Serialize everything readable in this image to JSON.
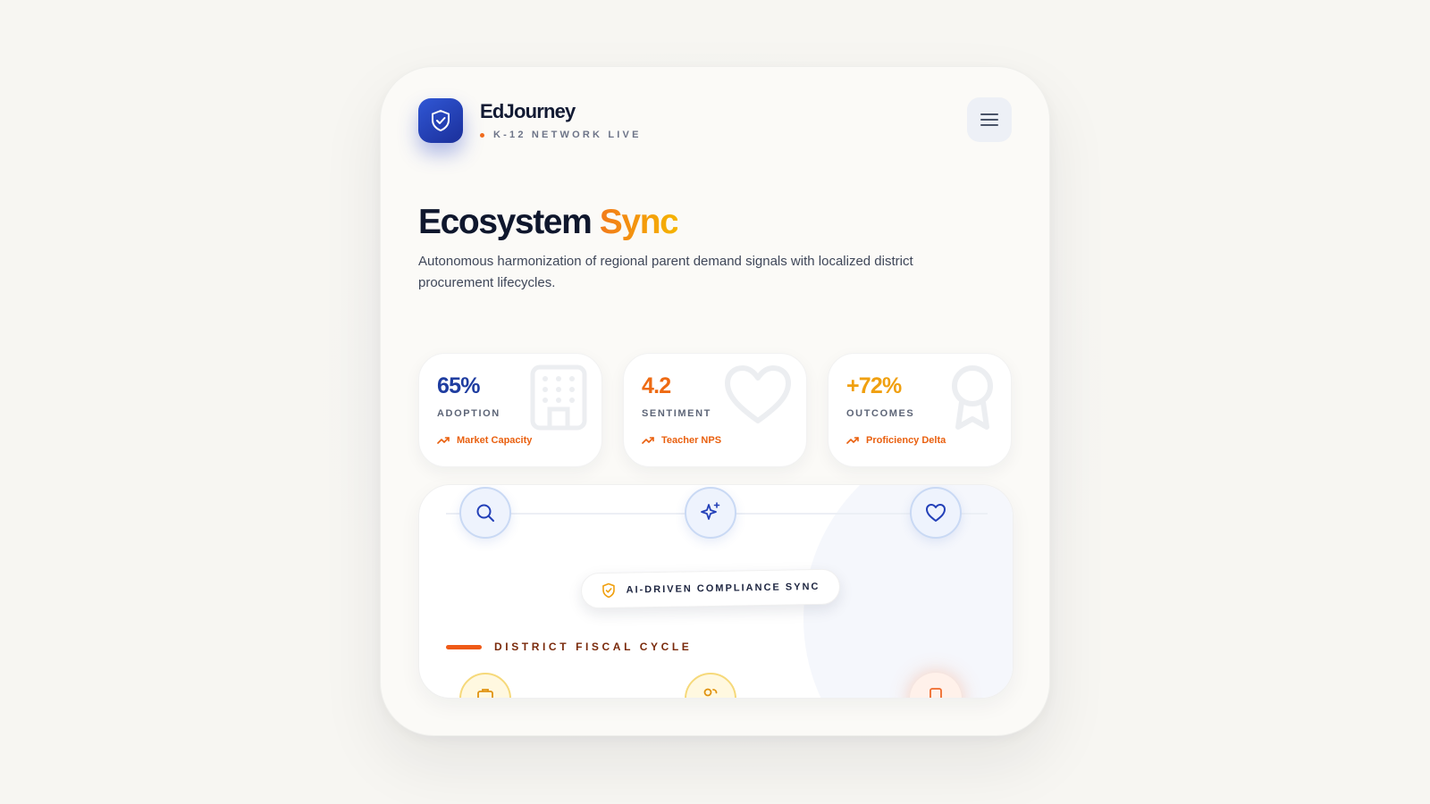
{
  "brand": {
    "name": "EdJourney",
    "status": "K-12 NETWORK LIVE",
    "logo_icon": "shield-check-icon",
    "accent_color": "#2a46c0"
  },
  "header": {
    "menu_icon": "hamburger-menu-icon"
  },
  "hero": {
    "title_main": "Ecosystem",
    "title_accent": "Sync",
    "description": "Autonomous harmonization of regional parent demand signals with localized district procurement lifecycles."
  },
  "stats": [
    {
      "value": "65%",
      "label": "ADOPTION",
      "trend": "Market Capacity",
      "icon": "building-icon",
      "color": "#1f3da0"
    },
    {
      "value": "4.2",
      "label": "SENTIMENT",
      "trend": "Teacher NPS",
      "icon": "heart-icon",
      "color": "#ee6a12"
    },
    {
      "value": "+72%",
      "label": "OUTCOMES",
      "trend": "Proficiency Delta",
      "icon": "award-icon",
      "color": "#f0a010"
    }
  ],
  "lifecycle": {
    "nodes_top": [
      "search-icon",
      "sparkle-icon",
      "heart-icon"
    ],
    "badge": "AI-DRIVEN COMPLIANCE SYNC",
    "section_label": "DISTRICT FISCAL CYCLE",
    "nodes_bottom": [
      "briefcase-icon",
      "users-icon",
      "document-icon"
    ]
  }
}
